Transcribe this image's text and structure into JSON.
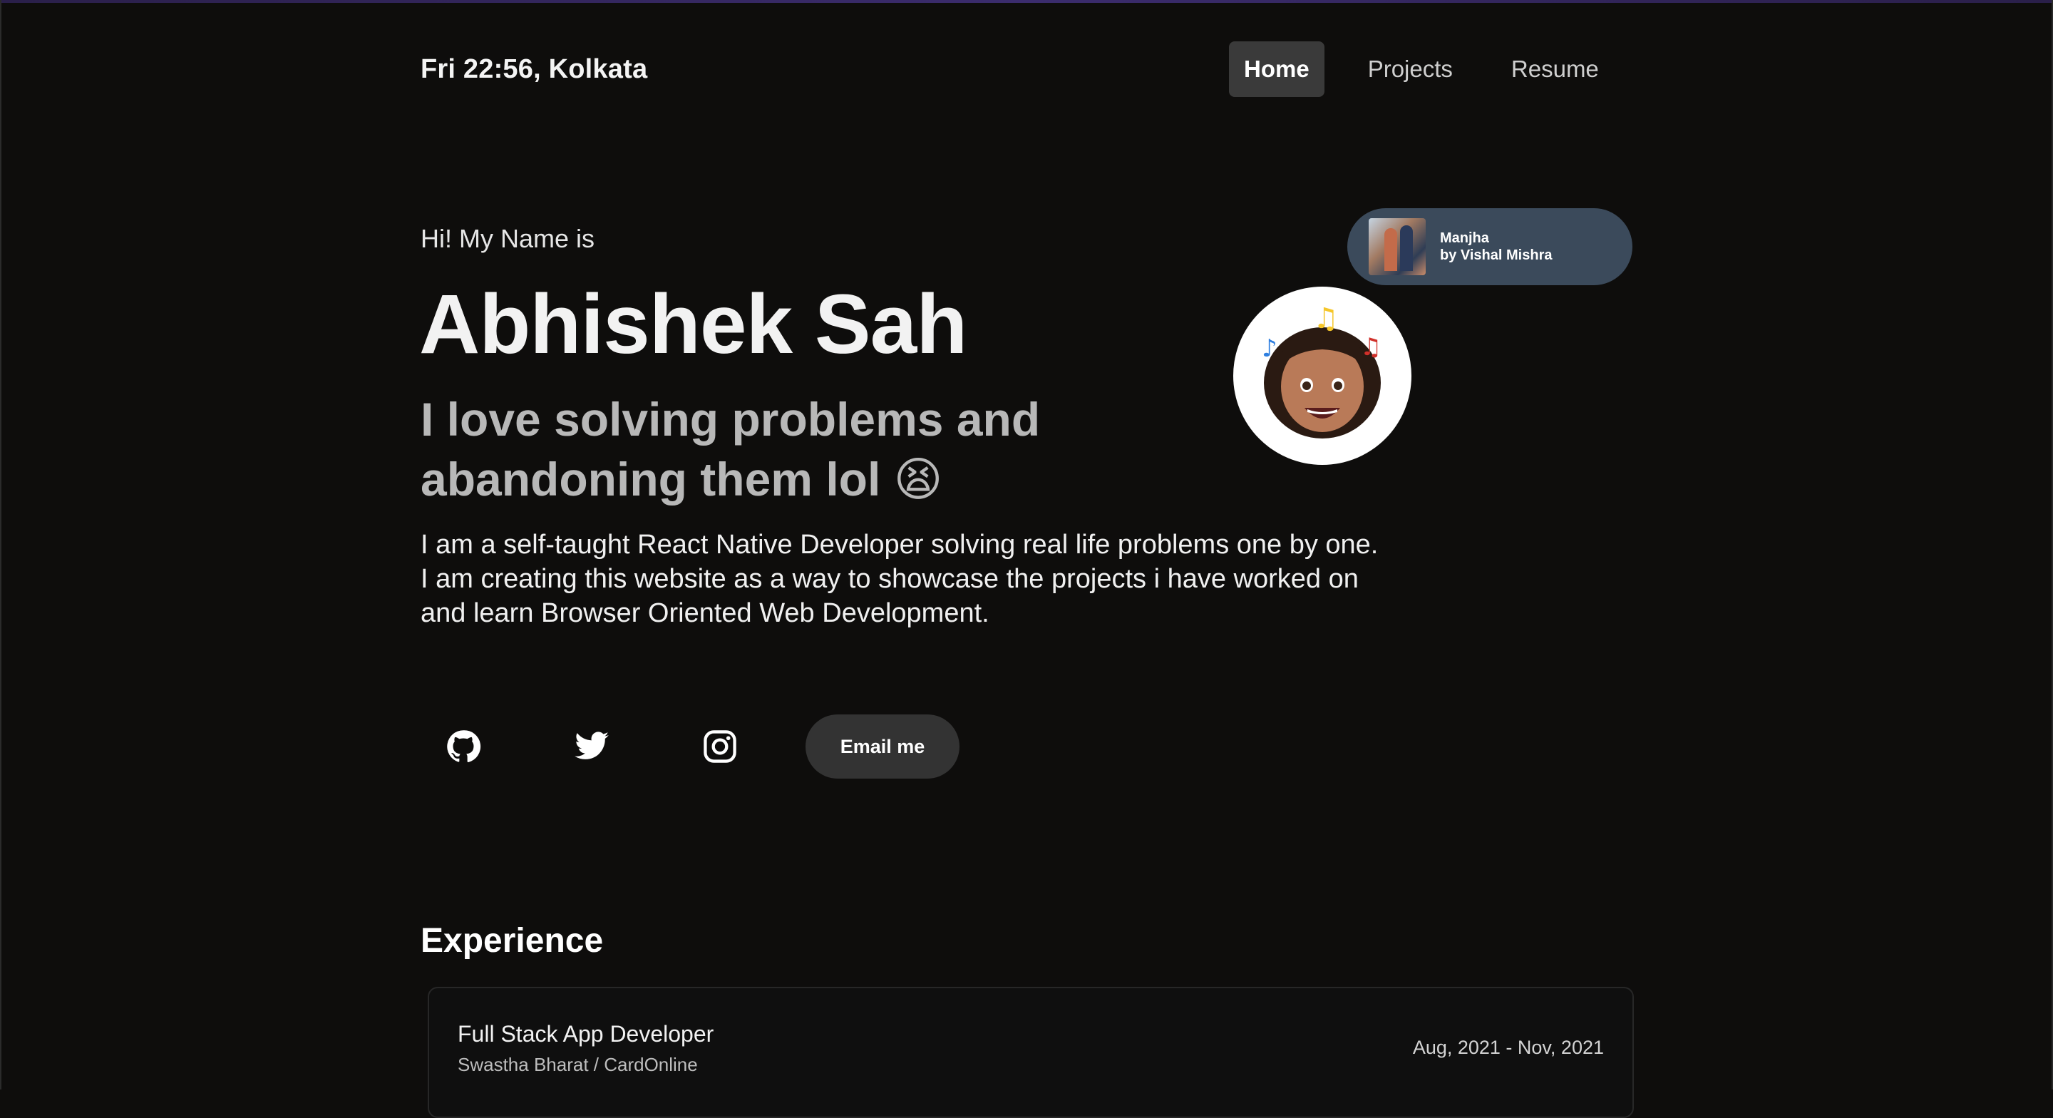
{
  "header": {
    "clock": "Fri 22:56, Kolkata",
    "nav": [
      {
        "label": "Home",
        "active": true
      },
      {
        "label": "Projects",
        "active": false
      },
      {
        "label": "Resume",
        "active": false
      }
    ]
  },
  "hero": {
    "greeting": "Hi! My Name is",
    "name": "Abhishek Sah",
    "tagline": "I love solving problems and abandoning them lol 😫",
    "bio": "I am a self-taught React Native Developer solving real life problems one by one. I am creating this website as a way to showcase the projects i have worked on and learn Browser Oriented Web Development."
  },
  "social": {
    "icons": [
      "github-icon",
      "twitter-icon",
      "instagram-icon"
    ],
    "email_label": "Email me"
  },
  "now_playing": {
    "track": "Manjha",
    "artist_line": "by Vishal Mishra"
  },
  "experience": {
    "title": "Experience",
    "items": [
      {
        "role": "Full Stack App Developer",
        "company": "Swastha Bharat / CardOnline",
        "dates": "Aug, 2021 - Nov, 2021"
      }
    ]
  },
  "colors": {
    "background": "#0e0d0c",
    "nav_active_bg": "#3a3a3a",
    "pill_bg": "#3b4a5b",
    "button_bg": "#333333"
  }
}
